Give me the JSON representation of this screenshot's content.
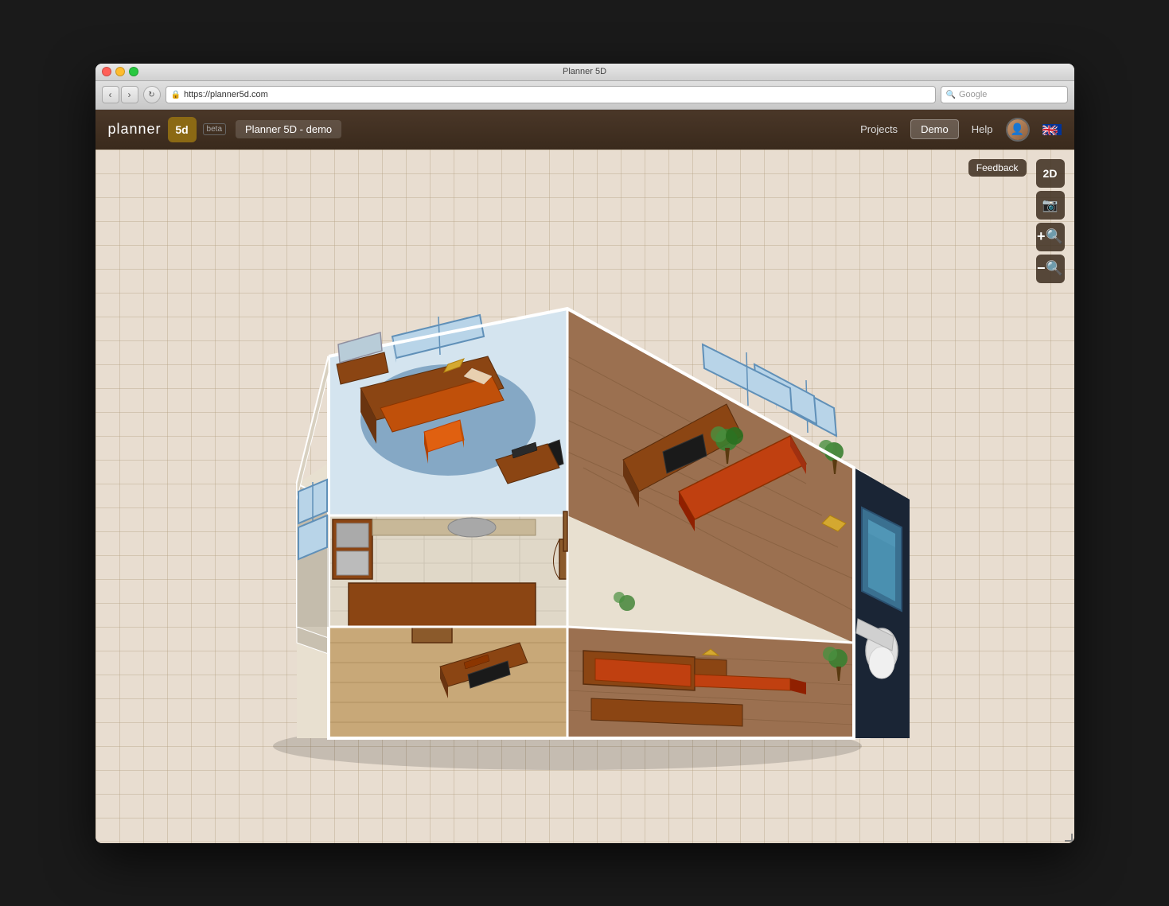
{
  "window": {
    "title": "Planner 5D",
    "url": "https://planner5d.com",
    "search_placeholder": "Google"
  },
  "header": {
    "logo_text": "planner",
    "logo_badge": "5d",
    "beta_label": "beta",
    "project_name": "Planner 5D - demo",
    "nav": {
      "projects_label": "Projects",
      "demo_label": "Demo",
      "help_label": "Help"
    }
  },
  "toolbar": {
    "feedback_label": "Feedback",
    "view_2d_label": "2D",
    "screenshot_icon": "camera",
    "zoom_in_icon": "zoom-in",
    "zoom_out_icon": "zoom-out"
  },
  "canvas": {
    "background_color": "#e8ddd0",
    "grid_color": "#c8b89a"
  }
}
